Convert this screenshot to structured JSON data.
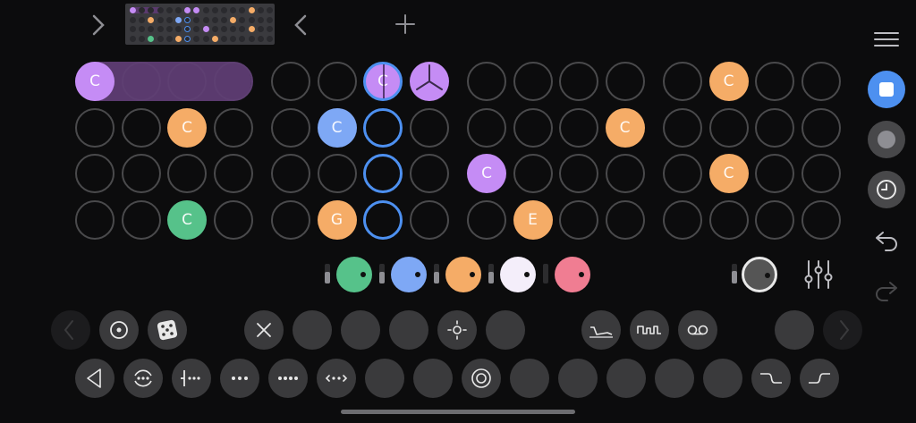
{
  "colors": {
    "purple": "#c58cf5",
    "purple_dim": "#5a3a6e",
    "orange": "#f5ac67",
    "green": "#56c28a",
    "blue": "#7ea8f5",
    "white": "#f4eefa",
    "pink": "#f07d92",
    "select": "#4d90f0",
    "accent_blue": "#4d90f0"
  },
  "header": {
    "forward_icon": "chevron-right-icon",
    "back_icon": "chevron-left-icon",
    "add_icon": "plus-icon"
  },
  "sidebar": {
    "menu_icon": "hamburger-menu-icon",
    "stop_icon": "stop-square-icon",
    "record_icon": "record-circle-icon",
    "clock_icon": "clock-icon",
    "undo_icon": "undo-arrow-icon",
    "redo_icon": "redo-arrow-icon"
  },
  "pads": {
    "rows": [
      [
        {
          "note": "C",
          "color": "purple"
        },
        {
          "note": "",
          "color": "purple_span"
        },
        {
          "note": "",
          "color": "purple_span"
        },
        {
          "note": "",
          "color": "purple_span"
        },
        {
          "note": "",
          "color": ""
        },
        {
          "note": "",
          "color": ""
        },
        {
          "note": "C",
          "color": "purple",
          "sel": true
        },
        {
          "note": "",
          "color": "purple",
          "icon": true
        },
        {
          "note": "",
          "color": ""
        },
        {
          "note": "",
          "color": ""
        },
        {
          "note": "",
          "color": ""
        },
        {
          "note": "",
          "color": ""
        },
        {
          "note": "",
          "color": ""
        },
        {
          "note": "C",
          "color": "orange"
        },
        {
          "note": "",
          "color": ""
        },
        {
          "note": "",
          "color": ""
        }
      ],
      [
        {
          "note": "",
          "color": ""
        },
        {
          "note": "",
          "color": ""
        },
        {
          "note": "C",
          "color": "orange"
        },
        {
          "note": "",
          "color": ""
        },
        {
          "note": "",
          "color": ""
        },
        {
          "note": "C",
          "color": "blue"
        },
        {
          "note": "",
          "color": "",
          "sel": true
        },
        {
          "note": "",
          "color": ""
        },
        {
          "note": "",
          "color": ""
        },
        {
          "note": "",
          "color": ""
        },
        {
          "note": "",
          "color": ""
        },
        {
          "note": "C",
          "color": "orange"
        },
        {
          "note": "",
          "color": ""
        },
        {
          "note": "",
          "color": ""
        },
        {
          "note": "",
          "color": ""
        },
        {
          "note": "",
          "color": ""
        }
      ],
      [
        {
          "note": "",
          "color": ""
        },
        {
          "note": "",
          "color": ""
        },
        {
          "note": "",
          "color": ""
        },
        {
          "note": "",
          "color": ""
        },
        {
          "note": "",
          "color": ""
        },
        {
          "note": "",
          "color": ""
        },
        {
          "note": "",
          "color": "",
          "sel": true
        },
        {
          "note": "",
          "color": ""
        },
        {
          "note": "C",
          "color": "purple"
        },
        {
          "note": "",
          "color": ""
        },
        {
          "note": "",
          "color": ""
        },
        {
          "note": "",
          "color": ""
        },
        {
          "note": "",
          "color": ""
        },
        {
          "note": "C",
          "color": "orange"
        },
        {
          "note": "",
          "color": ""
        },
        {
          "note": "",
          "color": ""
        }
      ],
      [
        {
          "note": "",
          "color": ""
        },
        {
          "note": "",
          "color": ""
        },
        {
          "note": "C",
          "color": "green"
        },
        {
          "note": "",
          "color": ""
        },
        {
          "note": "",
          "color": ""
        },
        {
          "note": "G",
          "color": "orange"
        },
        {
          "note": "",
          "color": "",
          "sel": true
        },
        {
          "note": "",
          "color": ""
        },
        {
          "note": "",
          "color": ""
        },
        {
          "note": "E",
          "color": "orange"
        },
        {
          "note": "",
          "color": ""
        },
        {
          "note": "",
          "color": ""
        },
        {
          "note": "",
          "color": ""
        },
        {
          "note": "",
          "color": ""
        },
        {
          "note": "",
          "color": ""
        },
        {
          "note": "",
          "color": ""
        }
      ]
    ]
  },
  "mixer": {
    "channels": [
      {
        "name": "green-knob",
        "color": "green",
        "level": 0.6
      },
      {
        "name": "blue-knob",
        "color": "blue",
        "level": 0.6
      },
      {
        "name": "orange-knob",
        "color": "orange",
        "level": 0.6
      },
      {
        "name": "white-knob",
        "color": "white",
        "level": 0.6
      },
      {
        "name": "pink-knob",
        "color": "pink",
        "level": 0.0
      }
    ],
    "master_icon": "master-volume-knob-icon",
    "mixer_icon": "mixer-sliders-icon"
  },
  "toolbar_row1": [
    {
      "name": "prev-page-button",
      "icon": "chevron-left-icon",
      "dim": true
    },
    {
      "name": "target-button",
      "icon": "target-icon"
    },
    {
      "name": "dice-button",
      "icon": "dice-icon"
    },
    {
      "name": "clear-button",
      "icon": "close-icon"
    },
    {
      "name": "empty-button-1",
      "icon": ""
    },
    {
      "name": "empty-button-2",
      "icon": ""
    },
    {
      "name": "empty-button-3",
      "icon": ""
    },
    {
      "name": "brightness-button",
      "icon": "sun-icon"
    },
    {
      "name": "empty-button-4",
      "icon": ""
    },
    {
      "name": "envelope-button",
      "icon": "envelope-icon"
    },
    {
      "name": "waveform-button",
      "icon": "square-wave-icon"
    },
    {
      "name": "tape-button",
      "icon": "tape-icon"
    },
    {
      "name": "empty-button-5",
      "icon": ""
    },
    {
      "name": "next-page-button",
      "icon": "chevron-right-icon",
      "dim": true
    }
  ],
  "toolbar_row2": [
    {
      "name": "play-reverse-button",
      "icon": "triangle-left-icon"
    },
    {
      "name": "loop-dots-button",
      "icon": "loop-dots-icon"
    },
    {
      "name": "start-marker-button",
      "icon": "start-marker-icon"
    },
    {
      "name": "three-dots-button",
      "icon": "three-dots-icon"
    },
    {
      "name": "four-dots-button",
      "icon": "four-dots-icon"
    },
    {
      "name": "arrows-dots-button",
      "icon": "arrows-dots-icon"
    },
    {
      "name": "empty-button-6",
      "icon": ""
    },
    {
      "name": "empty-button-7",
      "icon": ""
    },
    {
      "name": "ring-button",
      "icon": "ring-icon"
    },
    {
      "name": "empty-button-8",
      "icon": ""
    },
    {
      "name": "empty-button-9",
      "icon": ""
    },
    {
      "name": "empty-button-10",
      "icon": ""
    },
    {
      "name": "empty-button-11",
      "icon": ""
    },
    {
      "name": "empty-button-12",
      "icon": ""
    },
    {
      "name": "step-down-button",
      "icon": "step-down-icon"
    },
    {
      "name": "step-up-button",
      "icon": "step-up-icon"
    }
  ]
}
